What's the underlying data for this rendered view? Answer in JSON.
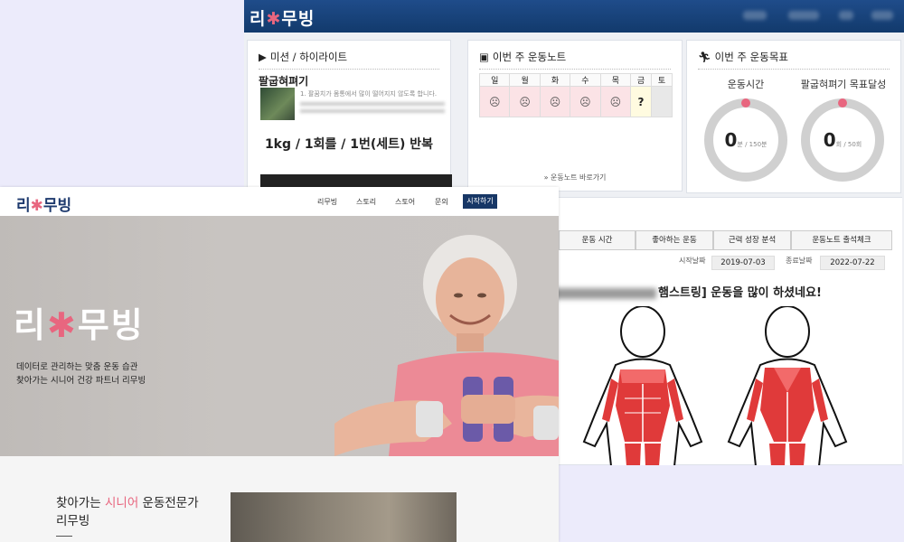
{
  "dashboard": {
    "logo": {
      "a": "리",
      "b": "무빙"
    },
    "mission": {
      "title": "미션 / 하이라이트",
      "icon": "youtube-icon",
      "exercise_name": "팔굽혀펴기",
      "desc": "1. 팔꿈치가 몸통에서 많이 떨어지지 않도록 합니다.",
      "reps": "1kg / 1회를 / 1번(세트) 반복"
    },
    "note": {
      "title": "이번 주 운동노트",
      "icon": "notebook-icon",
      "days": [
        "일",
        "월",
        "화",
        "수",
        "목",
        "금",
        "토"
      ],
      "marks": [
        "☹",
        "☹",
        "☹",
        "☹",
        "☹",
        "?",
        ""
      ],
      "link": "» 운동노트 바로가기"
    },
    "goal": {
      "title": "이번 주 운동목표",
      "icon": "running-icon",
      "items": [
        {
          "label": "운동시간",
          "value": "0",
          "unit": "분 / 150분",
          "progress": 0
        },
        {
          "label": "팔굽혀펴기 목표달성",
          "value": "0",
          "unit": "회 / 50회",
          "progress": 0
        }
      ]
    },
    "analysis": {
      "tabs": [
        "운동 시간",
        "좋아하는 운동",
        "근력 성장 분석",
        "운동노트 출석체크"
      ],
      "start_label": "시작날짜",
      "start_date": "2019-07-03",
      "end_label": "종료날짜",
      "end_date": "2022-07-22",
      "headline": "햄스트링] 운동을 많이 하셨네요!"
    }
  },
  "landing": {
    "logo": {
      "a": "리",
      "b": "무빙"
    },
    "nav": [
      "리무빙",
      "스토리",
      "스토어",
      "문의"
    ],
    "start_button": "시작하기",
    "hero_logo": {
      "a": "리",
      "b": "무빙"
    },
    "hero_lines": [
      "데이터로 관리하는 맞춤 운동 습관",
      "찾아가는 시니어 건강 파트너 리무빙"
    ],
    "section_title_pre": "찾아가는 ",
    "section_title_accent": "시니어",
    "section_title_post": " 운동전문가",
    "section_title_line2": "리무빙"
  },
  "colors": {
    "brand_navy": "#173766",
    "brand_pink": "#e8667f",
    "ring_gray": "#d0d0d0"
  }
}
